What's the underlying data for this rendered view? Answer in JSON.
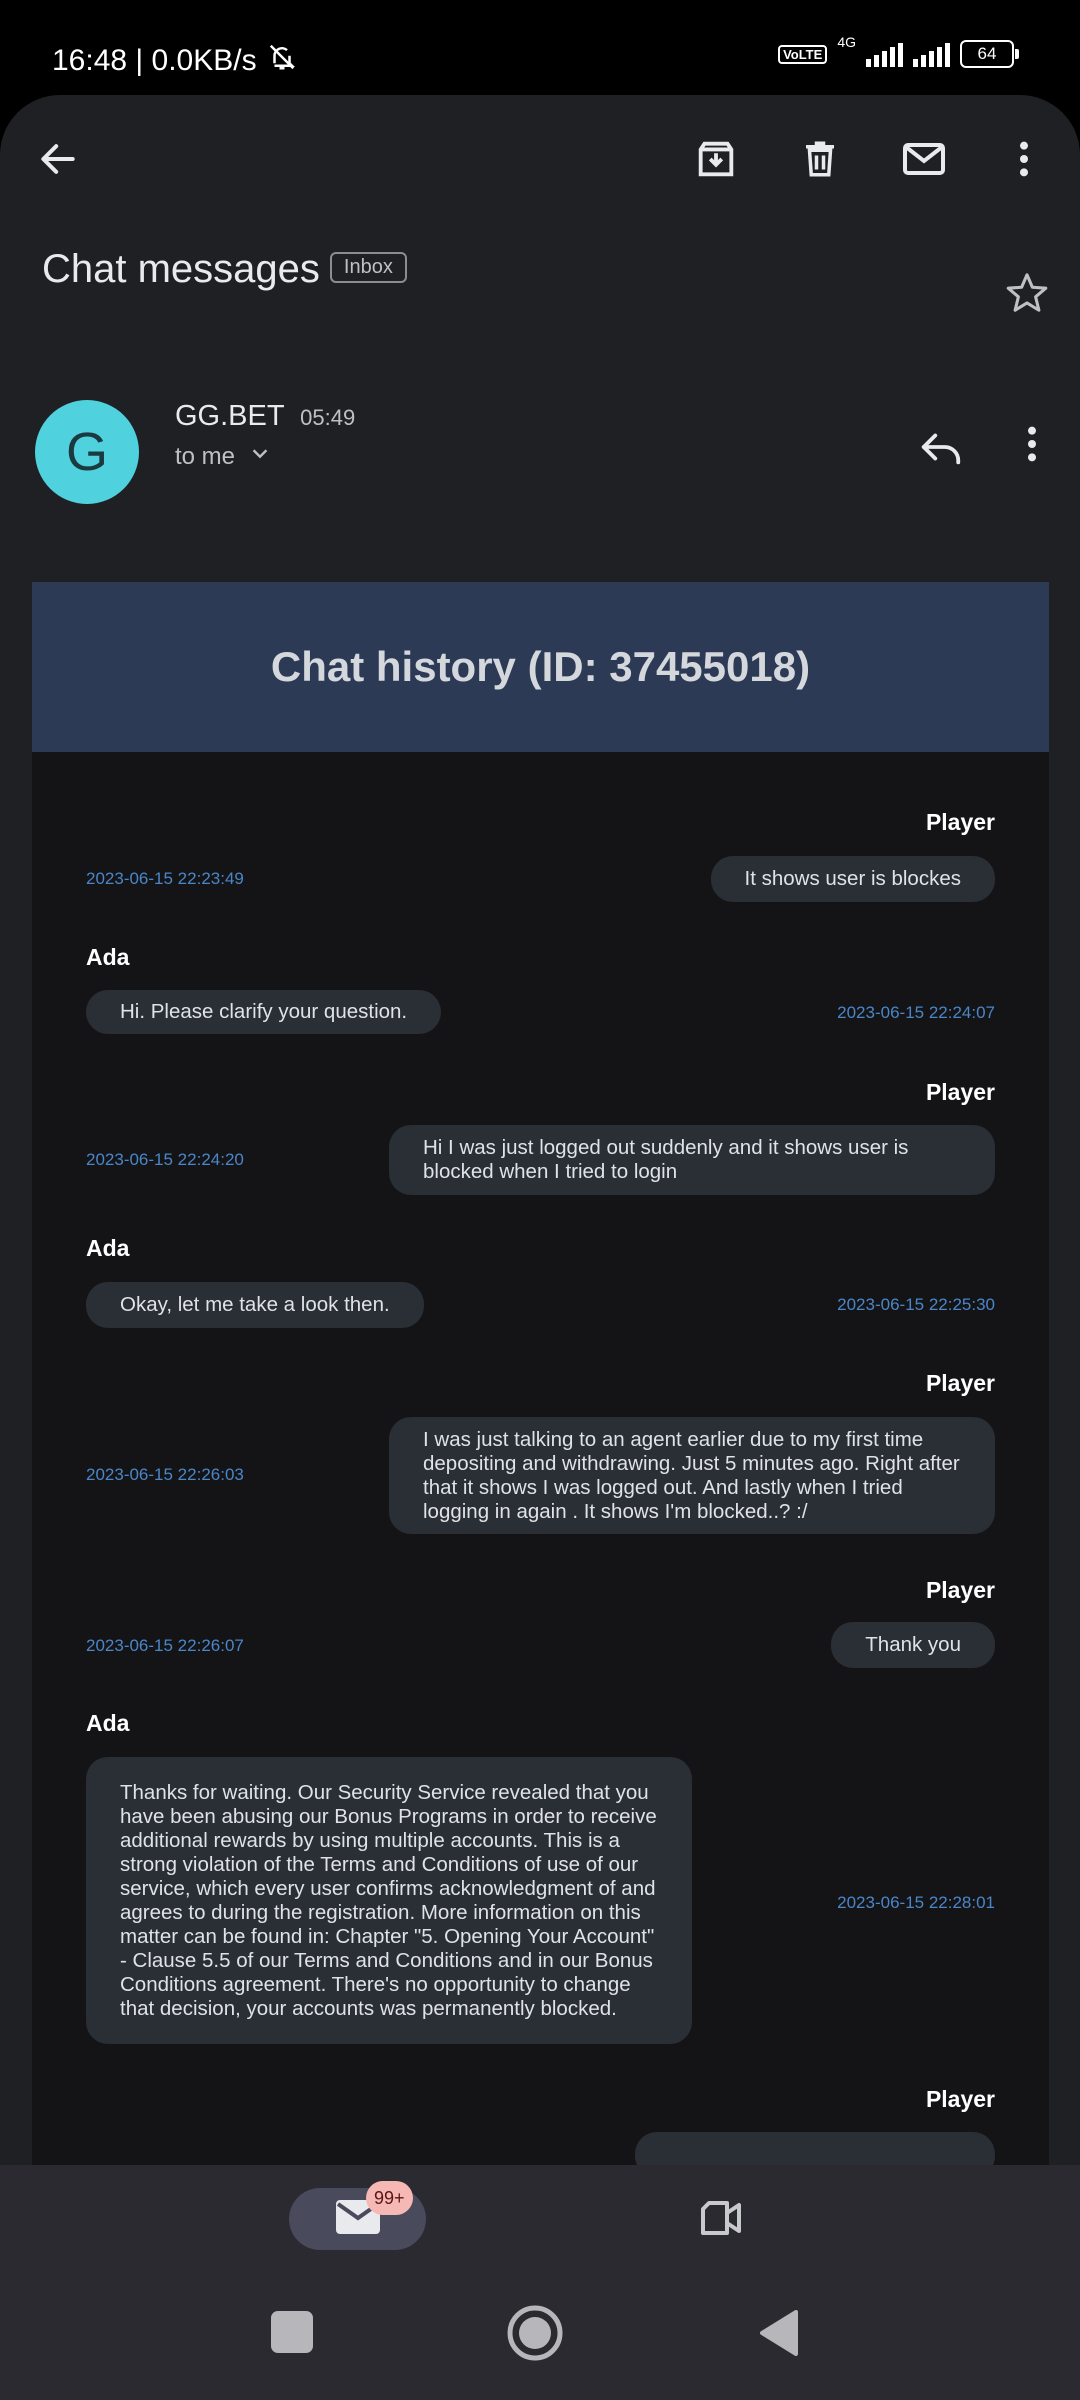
{
  "status_bar": {
    "time_net": "16:48 | 0.0KB/s",
    "volte": "Vo LTE",
    "network": "4G",
    "battery": "64"
  },
  "toolbar": {
    "icons": [
      "back-arrow-icon",
      "archive-icon",
      "delete-icon",
      "mark-unread-icon",
      "more-vert-icon"
    ]
  },
  "email": {
    "subject": "Chat messages",
    "label": "Inbox",
    "sender_name": "GG.BET",
    "sender_time": "05:49",
    "avatar_letter": "G",
    "recipient": "to me"
  },
  "chat": {
    "title": "Chat history (ID: 37455018)",
    "messages": [
      {
        "speaker": "Player",
        "text": "It shows user is blockes",
        "timestamp": "2023-06-15 22:23:49"
      },
      {
        "speaker": "Ada",
        "text": "Hi. Please clarify your question.",
        "timestamp": "2023-06-15 22:24:07"
      },
      {
        "speaker": "Player",
        "text": "Hi I was just logged out suddenly and it shows user is blocked when I tried to login",
        "timestamp": "2023-06-15 22:24:20"
      },
      {
        "speaker": "Ada",
        "text": "Okay, let me take a look then.",
        "timestamp": "2023-06-15 22:25:30"
      },
      {
        "speaker": "Player",
        "text": "I was just talking to an agent earlier due to my first time depositing and withdrawing. Just 5 minutes ago.  Right after that it shows I was logged out. And lastly when I tried logging in again . It shows I'm blocked..? :/",
        "timestamp": "2023-06-15 22:26:03"
      },
      {
        "speaker": "Player",
        "text": "Thank you",
        "timestamp": "2023-06-15 22:26:07"
      },
      {
        "speaker": "Ada",
        "text": "Thanks for waiting. Our Security Service revealed that you have been abusing our Bonus Programs in order to receive additional rewards by using multiple accounts. This is a strong violation of the Terms and Conditions of use of our service, which every user confirms acknowledgment of and agrees to during the registration. More information on this matter can be found in: Chapter \"5. Opening Your Account\" - Clause 5.5 of our Terms and Conditions and in our Bonus Conditions agreement. There's no opportunity to change that decision, your accounts was permanently blocked.",
        "timestamp": "2023-06-15 22:28:01"
      },
      {
        "speaker": "Player",
        "text": "",
        "timestamp": ""
      }
    ]
  },
  "bottom_nav": {
    "mail_badge": "99+",
    "icons": [
      "mail-icon",
      "meet-video-icon"
    ]
  },
  "system_nav": {
    "icons": [
      "recents-square-icon",
      "home-circle-icon",
      "back-triangle-icon"
    ]
  },
  "colors": {
    "background": "#1f2023",
    "avatar": "#4fd1de",
    "chat_header": "#2c3a56",
    "timestamp": "#4a86c8",
    "bubble": "#2a2e35",
    "badge": "#f6b8b4"
  }
}
